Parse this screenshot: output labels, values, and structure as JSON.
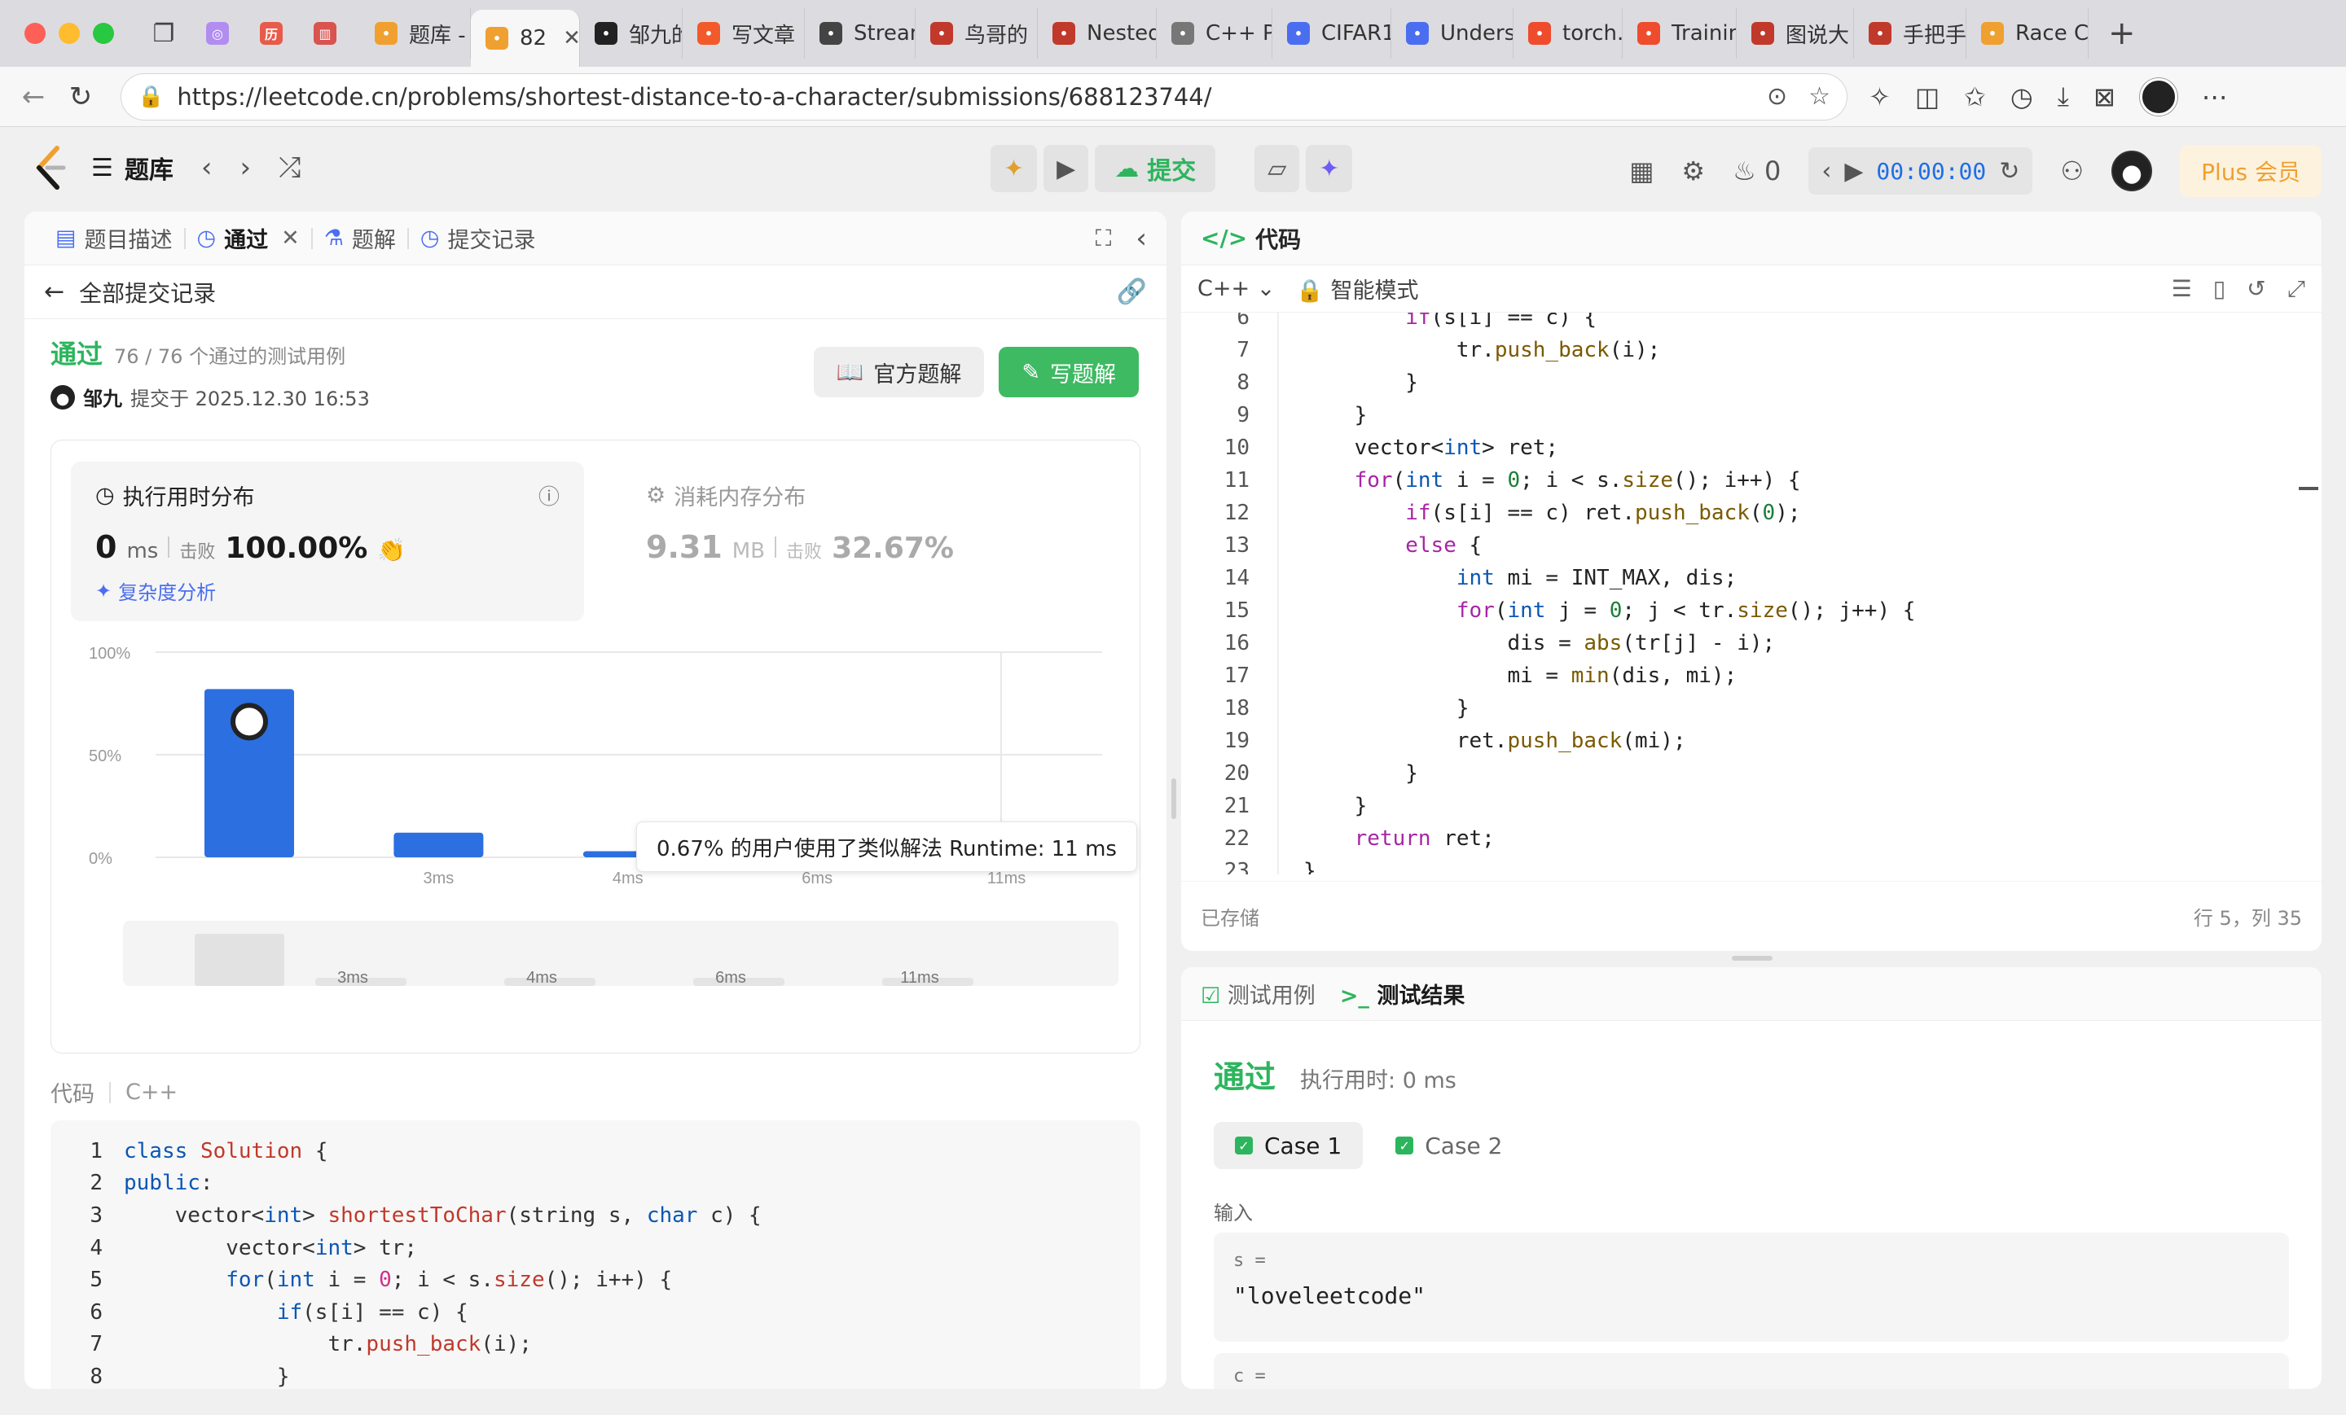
{
  "browser": {
    "tabs": [
      {
        "label": "题库 -",
        "icon": "leetcode-icon",
        "color": "#f0a030"
      },
      {
        "label": "82",
        "icon": "leetcode-icon",
        "color": "#f0a030",
        "active": true
      },
      {
        "label": "邹九的",
        "icon": "avatar-icon",
        "color": "#222222"
      },
      {
        "label": "写文章",
        "icon": "c-icon",
        "color": "#f25a2c"
      },
      {
        "label": "Stream",
        "icon": "dev-icon",
        "color": "#444444"
      },
      {
        "label": "鸟哥的",
        "icon": "pdf-icon",
        "color": "#c0392b"
      },
      {
        "label": "Nested",
        "icon": "pdf-icon",
        "color": "#c0392b"
      },
      {
        "label": "C++ Pr",
        "icon": "cpp-icon",
        "color": "#777777"
      },
      {
        "label": "CIFAR1",
        "icon": "search-icon",
        "color": "#4b6ef0"
      },
      {
        "label": "Unders",
        "icon": "site-icon",
        "color": "#4b6ef0"
      },
      {
        "label": "torch.p",
        "icon": "torch-icon",
        "color": "#ee4c2c"
      },
      {
        "label": "Trainin",
        "icon": "torch-icon",
        "color": "#ee4c2c"
      },
      {
        "label": "图说大",
        "icon": "pdf-icon",
        "color": "#c0392b"
      },
      {
        "label": "手把手",
        "icon": "pdf-icon",
        "color": "#c0392b"
      },
      {
        "label": "Race C",
        "icon": "leetcode-icon",
        "color": "#f0a030"
      }
    ],
    "url": "https://leetcode.cn/problems/shortest-distance-to-a-character/submissions/688123744/"
  },
  "appbar": {
    "tiku": "题库",
    "submit": "提交",
    "fire_count": "0",
    "timer": "00:00:00",
    "plus": "Plus 会员"
  },
  "left": {
    "tabs": {
      "desc": "题目描述",
      "passed": "通过",
      "solution": "题解",
      "records": "提交记录"
    },
    "back": "全部提交记录",
    "status": "通过",
    "tests": "76 / 76 个通过的测试用例",
    "user": "邹九",
    "submitted_at": "提交于 2025.12.30 16:53",
    "official_solution": "官方题解",
    "write_solution": "写题解",
    "runtime_title": "执行用时分布",
    "runtime_value": "0",
    "runtime_unit": "ms",
    "beat": "击败",
    "runtime_pct": "100.00%",
    "complexity": "复杂度分析",
    "memory_title": "消耗内存分布",
    "memory_value": "9.31",
    "memory_unit": "MB",
    "memory_pct": "32.67%",
    "tooltip": "0.67% 的用户使用了类似解法 Runtime: 11 ms",
    "code_label": "代码",
    "code_lang": "C++",
    "code_lines": [
      {
        "n": "1",
        "html": "<span class=\"k\">class</span> <span class=\"cls\">Solution</span> {"
      },
      {
        "n": "2",
        "html": "<span class=\"k\">public</span>:"
      },
      {
        "n": "3",
        "html": "    vector&lt;<span class=\"t\">int</span>&gt; <span class=\"fn\">shortestToChar</span>(string s, <span class=\"t\">char</span> c) {"
      },
      {
        "n": "4",
        "html": "        vector&lt;<span class=\"t\">int</span>&gt; tr;"
      },
      {
        "n": "5",
        "html": "        <span class=\"k\">for</span>(<span class=\"t\">int</span> i = <span class=\"num\">0</span>; i &lt; s.<span class=\"fn\">size</span>(); i++) {"
      },
      {
        "n": "6",
        "html": "            <span class=\"k\">if</span>(s[i] == c) {"
      },
      {
        "n": "7",
        "html": "                tr.<span class=\"fn\">push_back</span>(i);"
      },
      {
        "n": "8",
        "html": "            }"
      }
    ]
  },
  "chart_data": {
    "type": "bar",
    "title": "执行用时分布",
    "categories": [
      "0ms",
      "3ms",
      "4ms",
      "6ms",
      "11ms"
    ],
    "tick_labels": [
      "",
      "3ms",
      "4ms",
      "6ms",
      "11ms"
    ],
    "values": [
      82,
      12,
      3,
      3,
      3
    ],
    "ylim": [
      0,
      100
    ],
    "yticks": [
      "100%",
      "50%",
      "0%"
    ],
    "highlight_index": 0,
    "bar_color": "#2b6fe0",
    "minimap_labels": [
      "3ms",
      "4ms",
      "6ms",
      "11ms"
    ]
  },
  "editor": {
    "title": "代码",
    "lang": "C++",
    "mode": "智能模式",
    "saved": "已存储",
    "cursor": "行 5，列 35",
    "lines": [
      {
        "n": "6",
        "html": "        <span class=\"e-k\">if</span>(s[i] == c) {"
      },
      {
        "n": "7",
        "html": "            tr.<span class=\"e-fn\">push_back</span>(i);"
      },
      {
        "n": "8",
        "html": "        }"
      },
      {
        "n": "9",
        "html": "    }"
      },
      {
        "n": "10",
        "html": "    vector&lt;<span class=\"e-t\">int</span>&gt; ret;"
      },
      {
        "n": "11",
        "html": "    <span class=\"e-k\">for</span>(<span class=\"e-t\">int</span> i = <span class=\"e-num\">0</span>; i &lt; s.<span class=\"e-fn\">size</span>(); i++) {"
      },
      {
        "n": "12",
        "html": "        <span class=\"e-k\">if</span>(s[i] == c) ret.<span class=\"e-fn\">push_back</span>(<span class=\"e-num\">0</span>);"
      },
      {
        "n": "13",
        "html": "        <span class=\"e-k\">else</span> {"
      },
      {
        "n": "14",
        "html": "            <span class=\"e-t\">int</span> mi = INT_MAX, dis;"
      },
      {
        "n": "15",
        "html": "            <span class=\"e-k\">for</span>(<span class=\"e-t\">int</span> j = <span class=\"e-num\">0</span>; j &lt; tr.<span class=\"e-fn\">size</span>(); j++) {"
      },
      {
        "n": "16",
        "html": "                dis = <span class=\"e-fn\">abs</span>(tr[j] - i);"
      },
      {
        "n": "17",
        "html": "                mi = <span class=\"e-fn\">min</span>(dis, mi);"
      },
      {
        "n": "18",
        "html": "            }"
      },
      {
        "n": "19",
        "html": "            ret.<span class=\"e-fn\">push_back</span>(mi);"
      },
      {
        "n": "20",
        "html": "        }"
      },
      {
        "n": "21",
        "html": "    }"
      },
      {
        "n": "22",
        "html": "    <span class=\"e-k\">return</span> ret;"
      },
      {
        "n": "23",
        "html": "}"
      }
    ]
  },
  "results": {
    "tab_cases": "测试用例",
    "tab_results": "测试结果",
    "status": "通过",
    "runtime": "执行用时: 0 ms",
    "case1": "Case 1",
    "case2": "Case 2",
    "input_label": "输入",
    "var_s": "s =",
    "val_s": "\"loveleetcode\"",
    "var_c": "c ="
  }
}
